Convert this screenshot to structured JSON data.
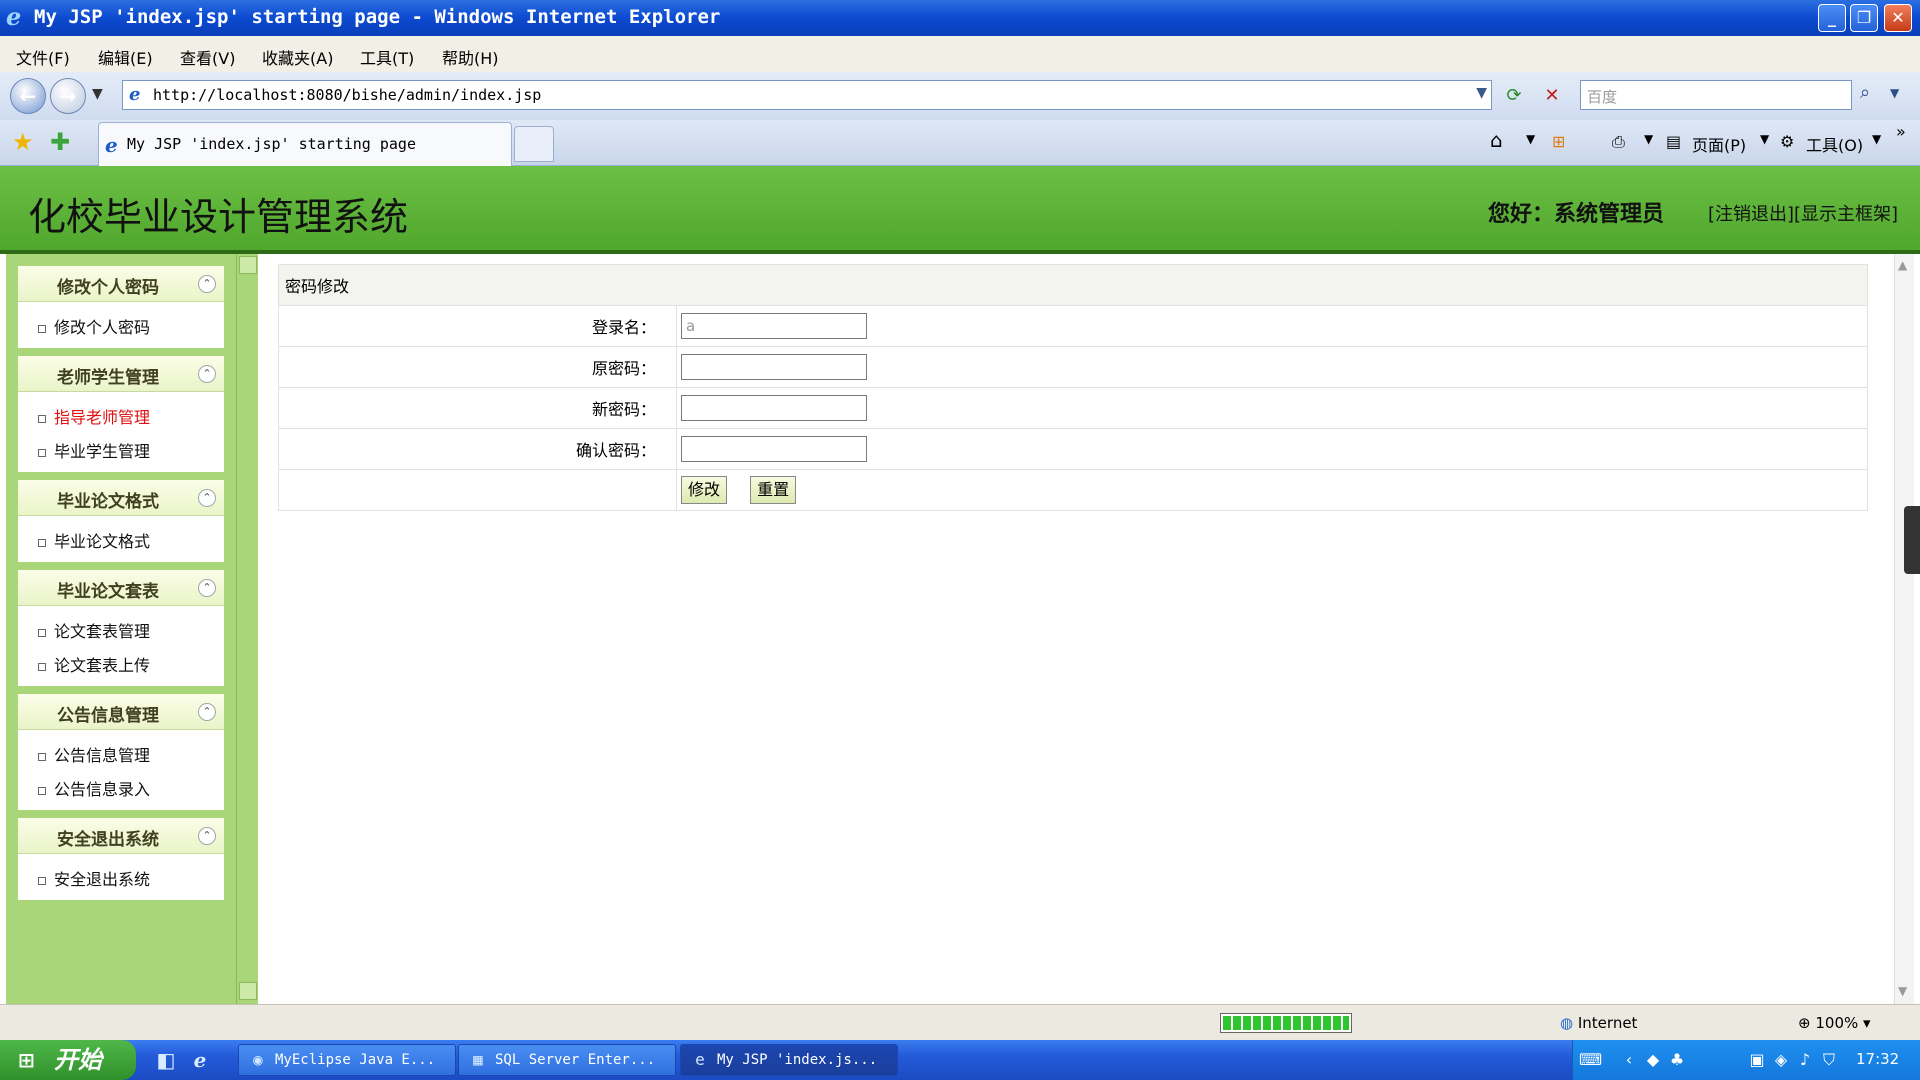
{
  "window": {
    "title": "My JSP 'index.jsp' starting page - Windows Internet Explorer",
    "controls": {
      "minimize": "_",
      "restore": "❐",
      "close": "✕"
    }
  },
  "menubar": [
    "文件(F)",
    "编辑(E)",
    "查看(V)",
    "收藏夹(A)",
    "工具(T)",
    "帮助(H)"
  ],
  "address": {
    "url": "http://localhost:8080/bishe/admin/index.jsp",
    "search_placeholder": "百度"
  },
  "tab": {
    "label": "My JSP 'index.jsp' starting page"
  },
  "commandbar": {
    "page_label": "页面(P)",
    "tools_label": "工具(O)"
  },
  "header": {
    "system_title": "化校毕业设计管理系统",
    "greeting": "您好：系统管理员",
    "logout_link": "[注销退出]",
    "show_frame_link": "[显示主框架]"
  },
  "sidebar": {
    "sections": [
      {
        "title": "修改个人密码",
        "items": [
          "修改个人密码"
        ]
      },
      {
        "title": "老师学生管理",
        "items": [
          "指导老师管理",
          "毕业学生管理"
        ]
      },
      {
        "title": "毕业论文格式",
        "items": [
          "毕业论文格式"
        ]
      },
      {
        "title": "毕业论文套表",
        "items": [
          "论文套表管理",
          "论文套表上传"
        ]
      },
      {
        "title": "公告信息管理",
        "items": [
          "公告信息管理",
          "公告信息录入"
        ]
      },
      {
        "title": "安全退出系统",
        "items": [
          "安全退出系统"
        ]
      }
    ],
    "active_item": "指导老师管理"
  },
  "form": {
    "caption": "密码修改",
    "fields": [
      {
        "label": "登录名：",
        "value": "a"
      },
      {
        "label": "原密码：",
        "value": ""
      },
      {
        "label": "新密码：",
        "value": ""
      },
      {
        "label": "确认密码：",
        "value": ""
      }
    ],
    "submit_label": "修改",
    "reset_label": "重置"
  },
  "statusbar": {
    "zone": "Internet",
    "zoom": "100%",
    "progress": 1.0
  },
  "taskbar": {
    "start_label": "开始",
    "tasks": [
      "MyEclipse Java E...",
      "SQL Server Enter...",
      "My JSP 'index.js..."
    ],
    "clock": "17:32"
  },
  "colors": {
    "header_green": "#5cb336",
    "sidebar_green": "#a8d678",
    "active_link": "#e01010",
    "titlebar_blue": "#0c4ad0"
  }
}
